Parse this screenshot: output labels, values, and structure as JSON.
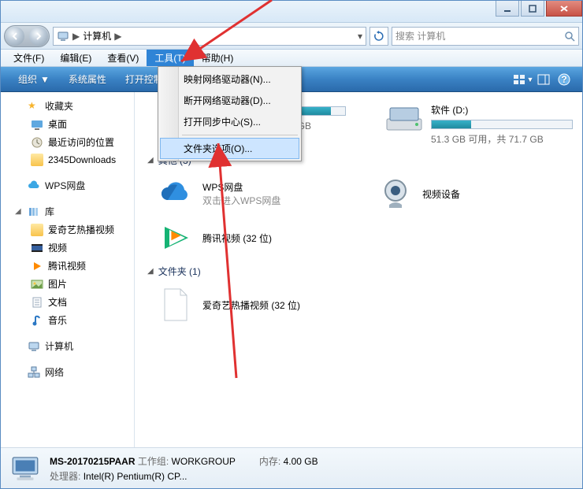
{
  "breadcrumb": {
    "location": "计算机",
    "sep": "▶"
  },
  "search": {
    "placeholder": "搜索 计算机"
  },
  "menus": {
    "file": "文件(F)",
    "edit": "编辑(E)",
    "view": "查看(V)",
    "tools": "工具(T)",
    "help": "帮助(H)"
  },
  "toolbar": {
    "organize": "组织",
    "properties": "系统属性",
    "open_control_panel": "打开控制面板"
  },
  "tools_menu": {
    "map_drive": "映射网络驱动器(N)...",
    "disconnect_drive": "断开网络驱动器(D)...",
    "sync_center": "打开同步中心(S)...",
    "folder_options": "文件夹选项(O)..."
  },
  "sidebar": {
    "favorites": {
      "label": "收藏夹",
      "items": [
        {
          "label": "桌面"
        },
        {
          "label": "最近访问的位置"
        },
        {
          "label": "2345Downloads"
        }
      ]
    },
    "wps": {
      "label": "WPS网盘"
    },
    "libraries": {
      "label": "库",
      "items": [
        {
          "label": "爱奇艺热播视频"
        },
        {
          "label": "视频"
        },
        {
          "label": "腾讯视频"
        },
        {
          "label": "图片"
        },
        {
          "label": "文档"
        },
        {
          "label": "音乐"
        }
      ]
    },
    "computer": {
      "label": "计算机"
    },
    "network": {
      "label": "网络"
    }
  },
  "content": {
    "drives": [
      {
        "name": "",
        "meta": "4.0 GB 可用，共 39.9 GB",
        "fill_pct": 90
      },
      {
        "name": "软件 (D:)",
        "meta": "51.3 GB 可用，共 71.7 GB",
        "fill_pct": 28
      }
    ],
    "section_other": "其他 (3)",
    "other_items": [
      {
        "name": "WPS网盘",
        "sub": "双击进入WPS网盘"
      },
      {
        "name": "视频设备",
        "sub": ""
      },
      {
        "name": "腾讯视频 (32 位)",
        "sub": ""
      }
    ],
    "section_folders": "文件夹 (1)",
    "folders": [
      {
        "name": "爱奇艺热播视频 (32 位)"
      }
    ]
  },
  "status": {
    "name": "MS-20170215PAAR",
    "workgroup_label": "工作组:",
    "workgroup": "WORKGROUP",
    "cpu_label": "处理器:",
    "cpu": "Intel(R) Pentium(R) CP...",
    "mem_label": "内存:",
    "mem": "4.00 GB"
  }
}
